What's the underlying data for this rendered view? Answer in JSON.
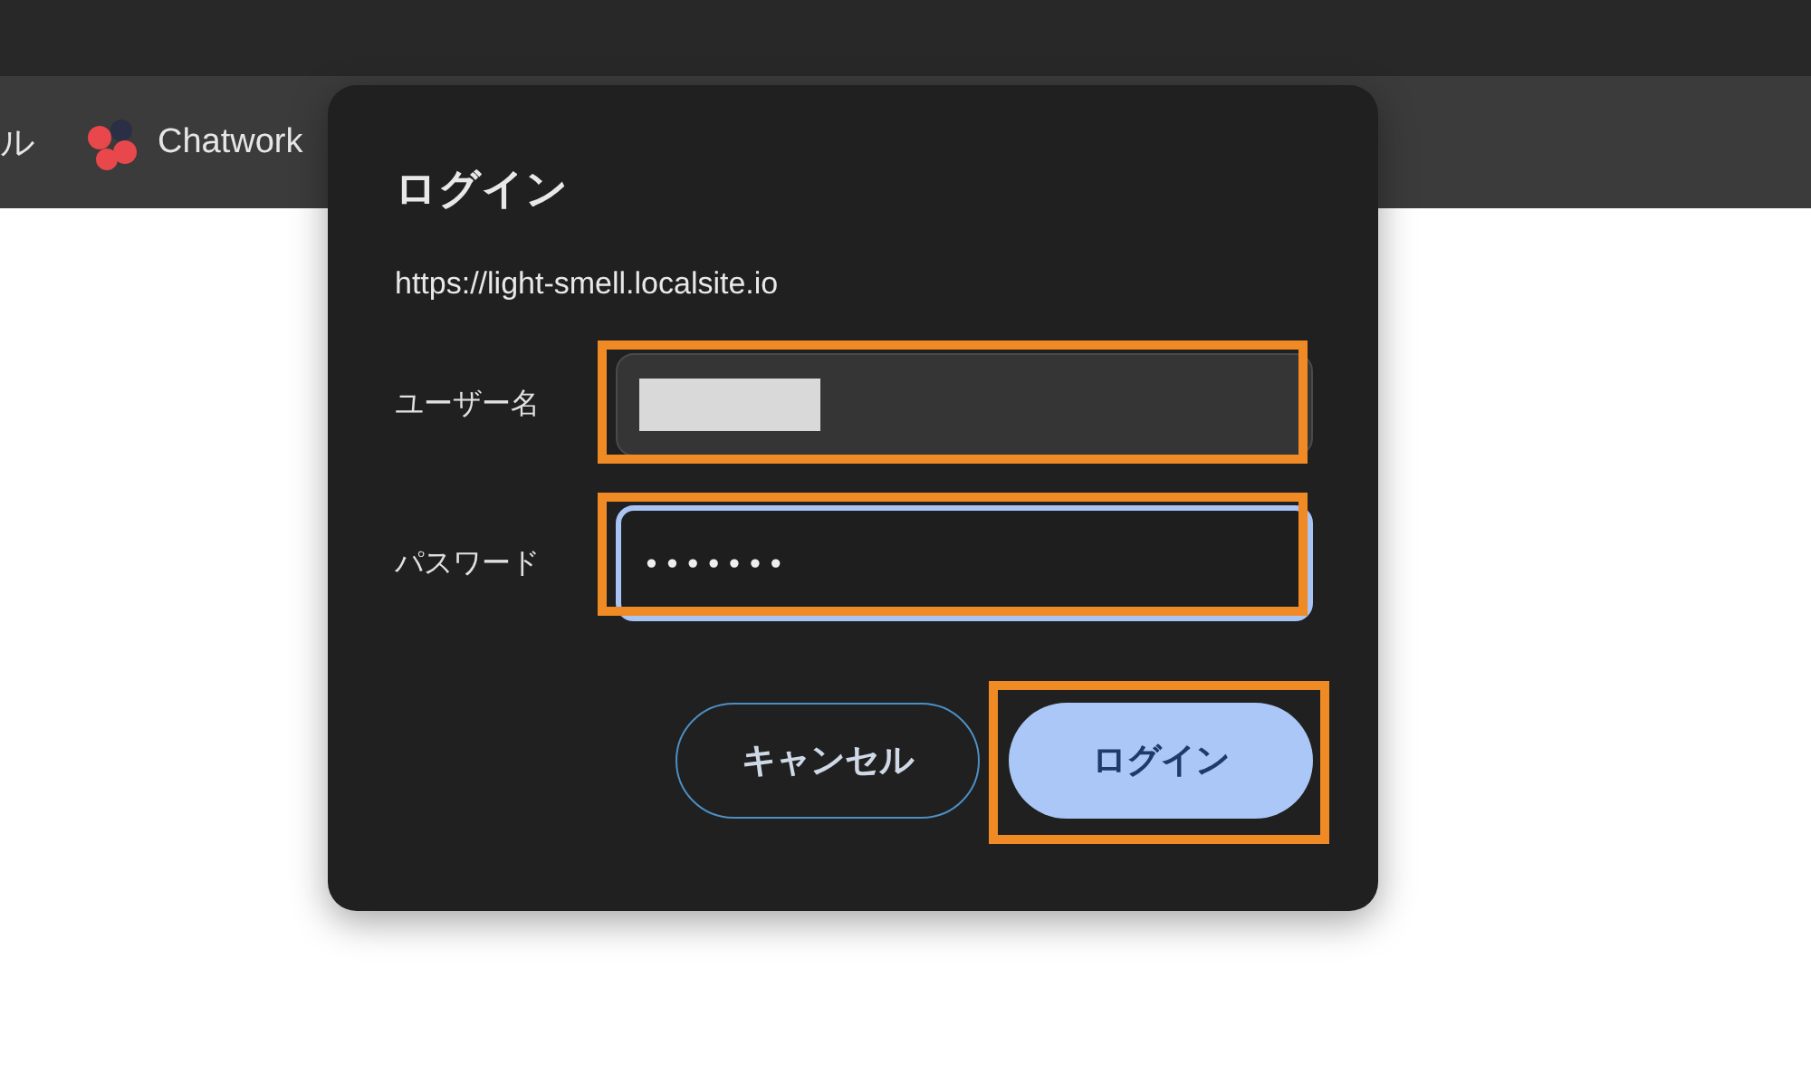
{
  "bookmarks": [
    {
      "label": "ル",
      "kind": "text"
    },
    {
      "label": "Chatwork",
      "kind": "app"
    }
  ],
  "dialog": {
    "title": "ログイン",
    "url": "https://light-smell.localsite.io",
    "fields": [
      {
        "label": "ユーザー名",
        "kind": "text",
        "value_redacted": true,
        "focused": false,
        "highlighted": true
      },
      {
        "label": "パスワード",
        "kind": "password",
        "value": "•••••••",
        "focused": true,
        "highlighted": true
      }
    ],
    "buttons": [
      {
        "label": "キャンセル",
        "kind": "secondary",
        "highlighted": false
      },
      {
        "label": "ログイン",
        "kind": "primary",
        "highlighted": true
      }
    ]
  }
}
